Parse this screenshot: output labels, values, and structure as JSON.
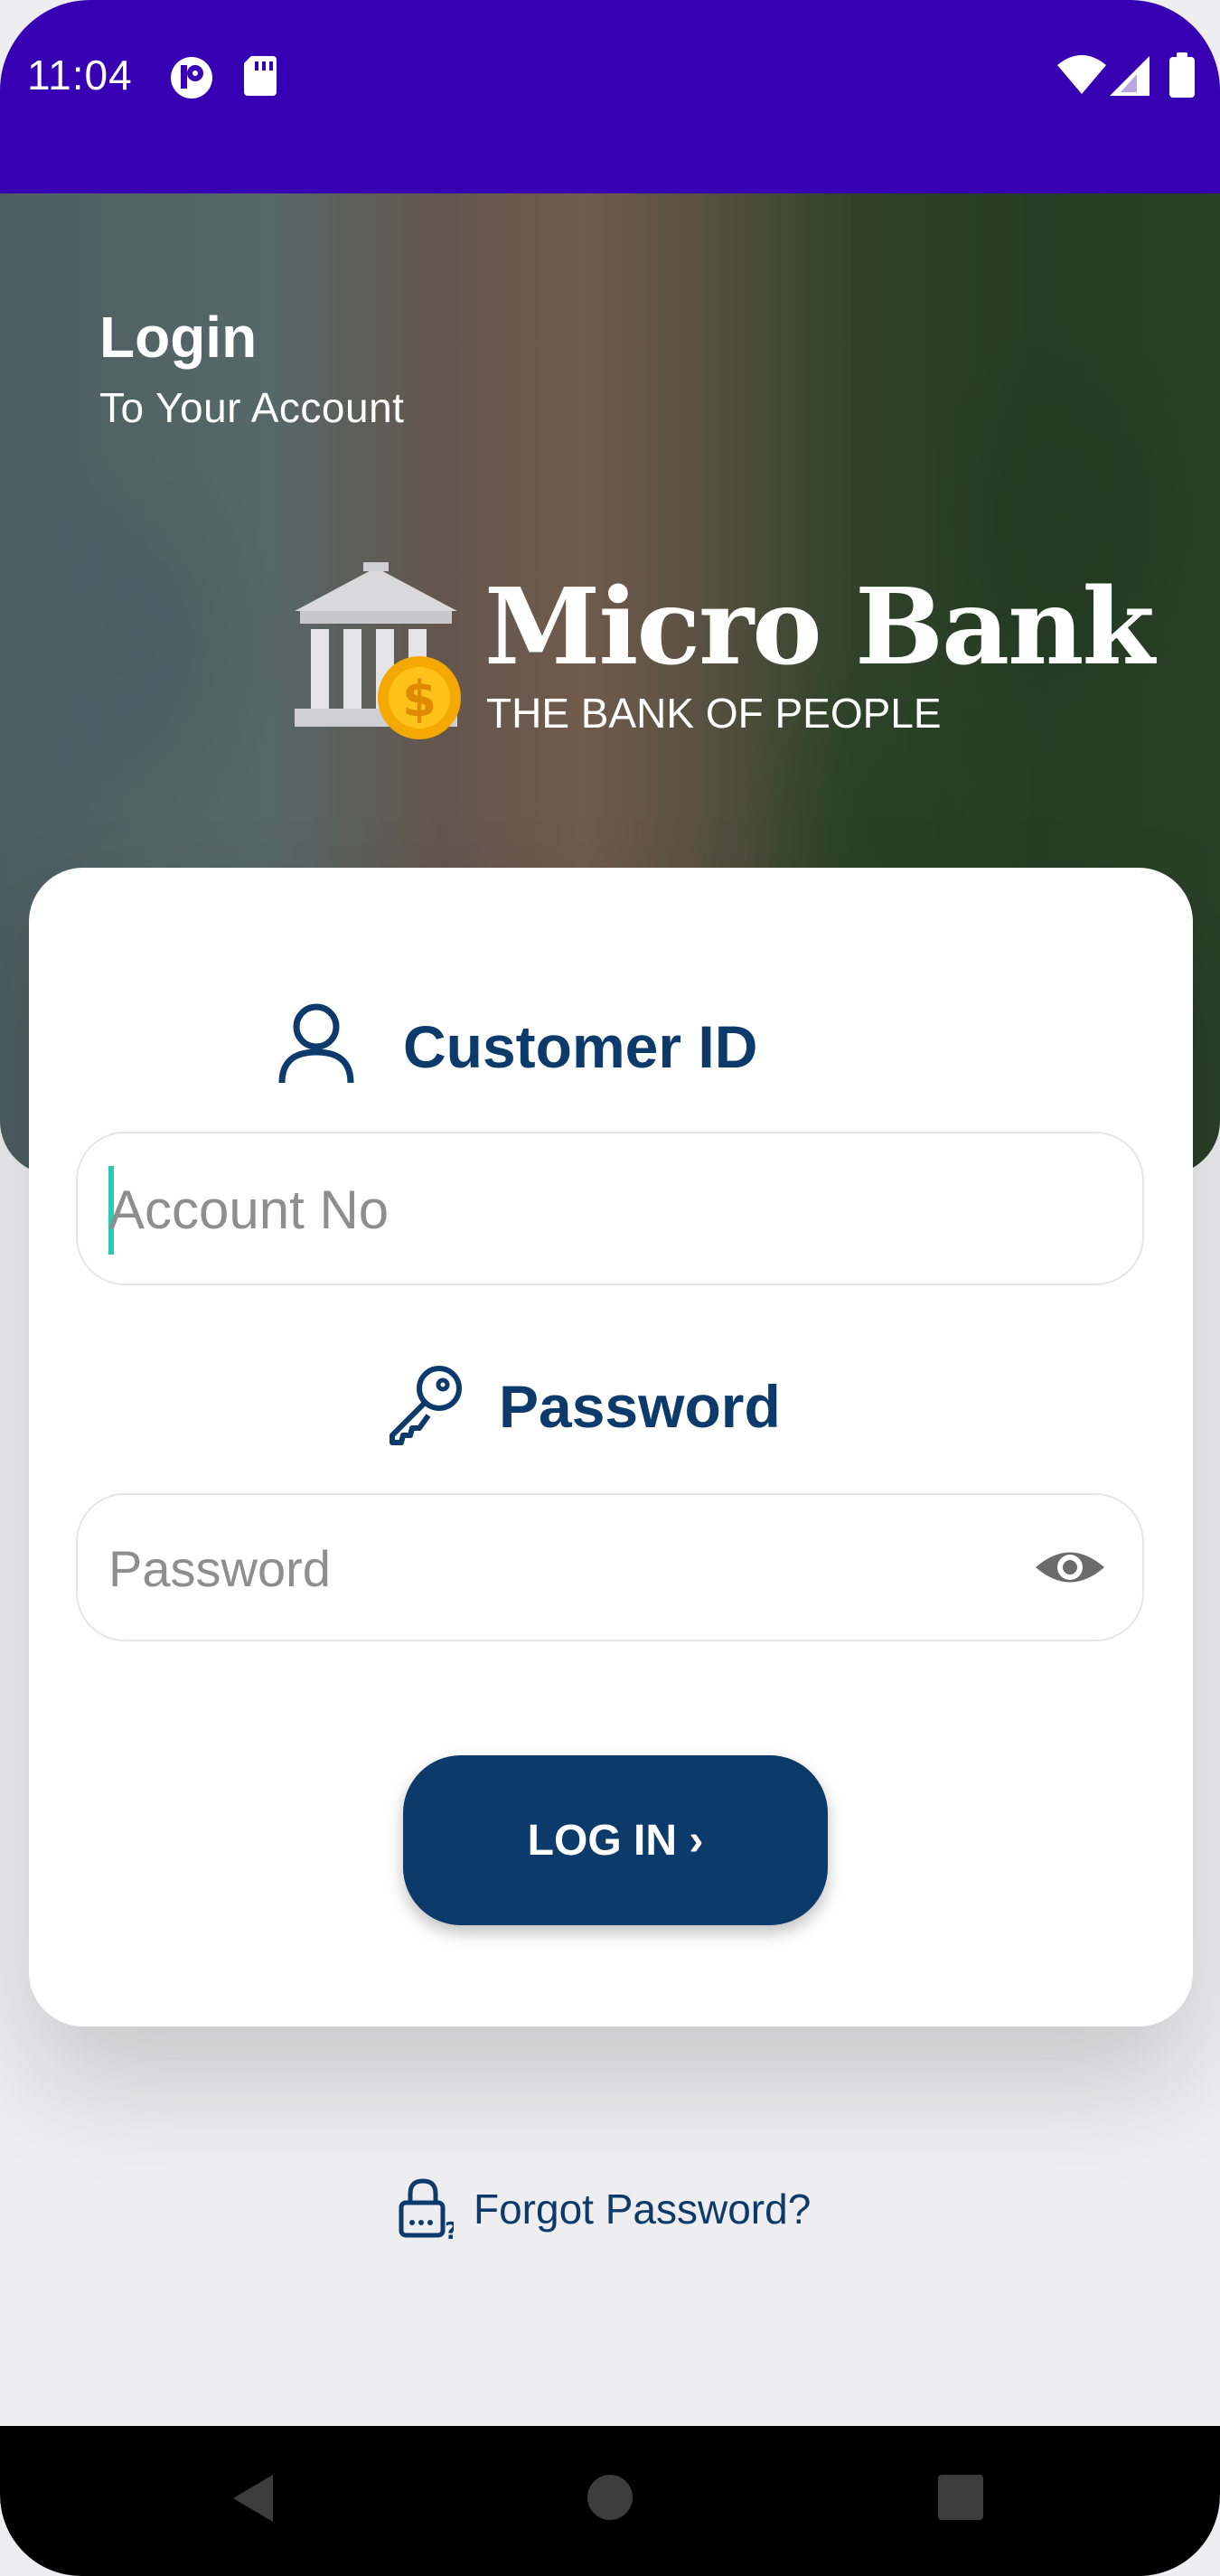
{
  "status_bar": {
    "time": "11:04",
    "icons": [
      "app-notification-icon",
      "sd-card-icon",
      "wifi-icon",
      "cellular-signal-icon",
      "battery-icon"
    ],
    "background_color": "#3800b3"
  },
  "header": {
    "title": "Login",
    "subtitle": "To Your Account"
  },
  "logo": {
    "name": "Micro Bank",
    "tagline": "THE BANK OF PEOPLE",
    "icon": "bank-building-icon"
  },
  "form": {
    "customer_id": {
      "label": "Customer ID",
      "icon": "user-icon",
      "placeholder": "Account No",
      "value": ""
    },
    "password": {
      "label": "Password",
      "icon": "key-icon",
      "placeholder": "Password",
      "value": "",
      "toggle_icon": "eye-icon"
    },
    "login_button": "LOG IN ›"
  },
  "forgot_password": {
    "label": "Forgot Password?",
    "icon": "lock-question-icon"
  },
  "nav_bar": {
    "icons": [
      "back-icon",
      "home-icon",
      "recents-icon"
    ]
  },
  "colors": {
    "primary": "#0b3a6b",
    "accent_caret": "#2bc8b6",
    "coin": "#f5a800"
  }
}
